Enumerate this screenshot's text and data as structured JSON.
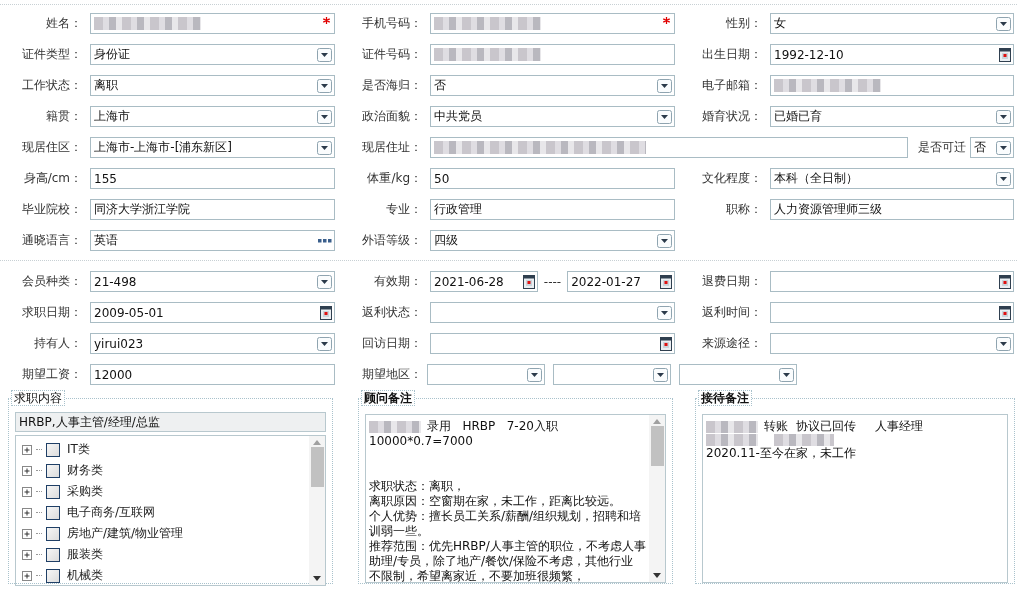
{
  "sections": [
    {
      "rows": [
        [
          {
            "label": "姓名：",
            "kind": "text",
            "redacted": true,
            "required": true
          },
          {
            "label": "手机号码：",
            "kind": "text",
            "redacted": true,
            "required": true
          },
          {
            "label": "性别：",
            "kind": "select",
            "value": "女"
          }
        ],
        [
          {
            "label": "证件类型：",
            "kind": "select",
            "value": "身份证"
          },
          {
            "label": "证件号码：",
            "kind": "text",
            "redacted": true
          },
          {
            "label": "出生日期：",
            "kind": "date",
            "value": "1992-12-10"
          }
        ],
        [
          {
            "label": "工作状态：",
            "kind": "select",
            "value": "离职"
          },
          {
            "label": "是否海归：",
            "kind": "select",
            "value": "否"
          },
          {
            "label": "电子邮箱：",
            "kind": "text",
            "redacted": true
          }
        ],
        [
          {
            "label": "籍贯：",
            "kind": "select",
            "value": "上海市"
          },
          {
            "label": "政治面貌：",
            "kind": "select",
            "value": "中共党员"
          },
          {
            "label": "婚育状况：",
            "kind": "select",
            "value": "已婚已育"
          }
        ],
        [
          {
            "label": "现居住区：",
            "kind": "select",
            "value": "上海市-上海市-[浦东新区]"
          },
          {
            "label": "现居住址：",
            "kind": "text",
            "redacted": true
          },
          {
            "label": "是否可迁",
            "kind": "select-mini",
            "value": "否"
          }
        ],
        [
          {
            "label": "身高/cm：",
            "kind": "text",
            "value": "155"
          },
          {
            "label": "体重/kg：",
            "kind": "text",
            "value": "50"
          },
          {
            "label": "文化程度：",
            "kind": "select",
            "value": "本科（全日制）"
          }
        ],
        [
          {
            "label": "毕业院校：",
            "kind": "text",
            "value": "同济大学浙江学院"
          },
          {
            "label": "专业：",
            "kind": "text",
            "value": "行政管理"
          },
          {
            "label": "职称：",
            "kind": "text",
            "value": "人力资源管理师三级"
          }
        ],
        [
          {
            "label": "通晓语言：",
            "kind": "lookup",
            "value": "英语"
          },
          {
            "label": "外语等级：",
            "kind": "select",
            "value": "四级"
          }
        ]
      ]
    },
    {
      "rows": [
        [
          {
            "label": "会员种类：",
            "kind": "select",
            "value": "21-498"
          },
          {
            "label": "有效期：",
            "kind": "date-range",
            "values": [
              "2021-06-28",
              "2022-01-27"
            ],
            "separator": "----"
          },
          {
            "label": "退费日期：",
            "kind": "date"
          }
        ],
        [
          {
            "label": "求职日期：",
            "kind": "date",
            "value": "2009-05-01"
          },
          {
            "label": "返利状态：",
            "kind": "select"
          },
          {
            "label": "返利时间：",
            "kind": "date"
          }
        ],
        [
          {
            "label": "持有人：",
            "kind": "select",
            "value": "yirui023"
          },
          {
            "label": "回访日期：",
            "kind": "date"
          },
          {
            "label": "来源途径：",
            "kind": "select"
          }
        ],
        [
          {
            "label": "期望工资：",
            "kind": "text",
            "value": "12000"
          },
          {
            "label": "期望地区：",
            "kind": "region-select"
          }
        ]
      ]
    }
  ],
  "panels": [
    {
      "kind": "tree",
      "title": "求职内容",
      "summary": "HRBP,人事主管/经理/总监",
      "items": [
        {
          "label": "IT类",
          "expanded": false,
          "checked": false
        },
        {
          "label": "财务类",
          "expanded": false,
          "checked": false
        },
        {
          "label": "采购类",
          "expanded": false,
          "checked": false
        },
        {
          "label": "电子商务/互联网",
          "expanded": false,
          "checked": false
        },
        {
          "label": "房地产/建筑/物业管理",
          "expanded": false,
          "checked": false
        },
        {
          "label": "服装类",
          "expanded": false,
          "checked": false
        },
        {
          "label": "机械类",
          "expanded": false,
          "checked": false
        }
      ]
    },
    {
      "kind": "memo",
      "title": "顾问备注",
      "scrollbar": true,
      "lines": [
        {
          "kind": "text",
          "redacted": true,
          "text": "录用   HRBP   7-20入职"
        },
        {
          "kind": "text",
          "redacted": false,
          "text": "10000*0.7=7000"
        },
        {
          "kind": "blank"
        },
        {
          "kind": "blank"
        },
        {
          "kind": "text",
          "redacted": false,
          "text": "求职状态：离职，"
        },
        {
          "kind": "text",
          "redacted": false,
          "text": "离职原因：空窗期在家，未工作，距离比较远。"
        },
        {
          "kind": "text",
          "redacted": false,
          "text": "个人优势：擅长员工关系/薪酬/组织规划，招聘和培"
        },
        {
          "kind": "text",
          "redacted": false,
          "text": "训弱一些。"
        },
        {
          "kind": "text",
          "redacted": false,
          "text": "推荐范围：优先HRBP/人事主管的职位，不考虑人事"
        },
        {
          "kind": "text",
          "redacted": false,
          "text": "助理/专员，除了地产/餐饮/保险不考虑，其他行业"
        },
        {
          "kind": "text",
          "redacted": false,
          "text": "不限制，希望离家近，不要加班很频繁，"
        }
      ]
    },
    {
      "kind": "memo",
      "title": "接待备注",
      "scrollbar": false,
      "lines": [
        {
          "kind": "text",
          "redacted": true,
          "text": "转账  协议已回传     人事经理"
        },
        {
          "kind": "text",
          "redacted": true
        },
        {
          "kind": "text",
          "redacted": false,
          "text": "2020.11-至今在家，未工作"
        }
      ]
    }
  ]
}
